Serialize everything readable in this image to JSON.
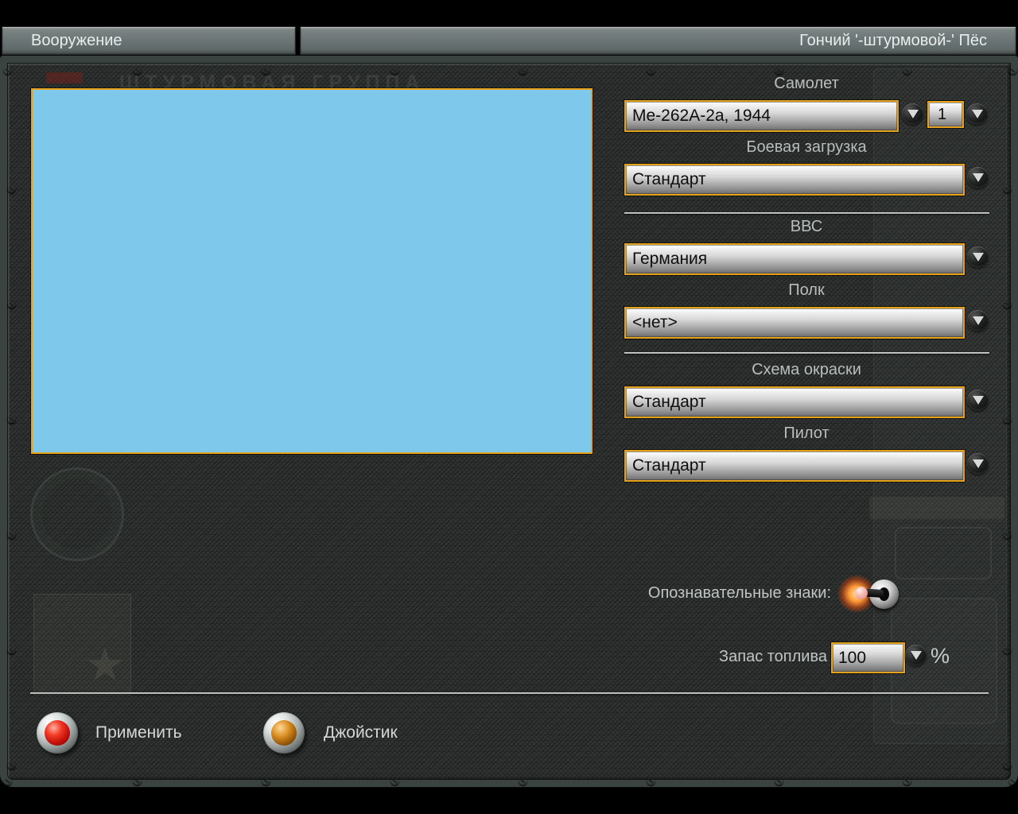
{
  "window": {
    "tab_left": "Вооружение",
    "tab_right": "Гончий '-штурмовой-' Пёс"
  },
  "background": {
    "ghost_text": "ШТУРМОВАЯ ГРУППА"
  },
  "form": {
    "aircraft": {
      "label": "Самолет",
      "value": "Me-262A-2a, 1944",
      "count": "1"
    },
    "loadout": {
      "label": "Боевая загрузка",
      "value": "Стандарт"
    },
    "airforce": {
      "label": "ВВС",
      "value": "Германия"
    },
    "regiment": {
      "label": "Полк",
      "value": "<нет>"
    },
    "paint": {
      "label": "Схема окраски",
      "value": "Стандарт"
    },
    "pilot": {
      "label": "Пилот",
      "value": "Стандарт"
    },
    "markings": {
      "label": "Опознавательные знаки:",
      "state": "on"
    },
    "fuel": {
      "label": "Запас топлива",
      "value": "100",
      "unit": "%"
    }
  },
  "buttons": {
    "apply": "Применить",
    "joystick": "Джойстик"
  },
  "colors": {
    "accent_gold": "#e7a21c",
    "preview_blue": "#7ec8ec",
    "toggle_glow_orange": "#ff9a36",
    "apply_button_red": "#c6100c",
    "joystick_button_amber": "#d98c20",
    "panel_dark": "#2b2f2d"
  }
}
